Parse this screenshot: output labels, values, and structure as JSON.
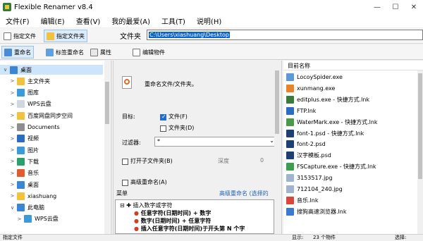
{
  "window": {
    "title": "Flexible Renamer v8.4",
    "minimize": "—",
    "maximize": "☐",
    "close": "✕"
  },
  "menu": [
    "文件(F)",
    "编辑(E)",
    "查看(V)",
    "我的最爱(A)",
    "工具(T)",
    "说明(H)"
  ],
  "toolbar1": {
    "specify_file": "指定文件",
    "specify_folder": "指定文件夹",
    "folder_label": "文件夹",
    "path": "C:\\Users\\xiashuang\\Desktop"
  },
  "toolbar2": {
    "rename": "重命名",
    "tag_rename": "标签重命名",
    "attributes": "属性",
    "edit_items": "编辑物件"
  },
  "tree": [
    {
      "label": "桌面",
      "icon_color": "#3a86d4",
      "chev": "∨",
      "selected": true
    },
    {
      "label": "主文件夹",
      "icon_color": "#f3c23c",
      "chev": ">"
    },
    {
      "label": "图库",
      "icon_color": "#3b9bd8",
      "chev": ">"
    },
    {
      "label": "WPS云盘",
      "icon_color": "#d0d7e2",
      "chev": ">"
    },
    {
      "label": "百度网盘同步空间",
      "icon_color": "#f3c23c",
      "chev": ">"
    },
    {
      "label": "Documents",
      "icon_color": "#8e8e8e",
      "chev": ">"
    },
    {
      "label": "视频",
      "icon_color": "#2b6cc4",
      "chev": ">"
    },
    {
      "label": "图片",
      "icon_color": "#3b9bd8",
      "chev": ">"
    },
    {
      "label": "下载",
      "icon_color": "#2aa06e",
      "chev": ">"
    },
    {
      "label": "音乐",
      "icon_color": "#e05c30",
      "chev": ">"
    },
    {
      "label": "桌面",
      "icon_color": "#3a86d4",
      "chev": ">"
    },
    {
      "label": "xiashuang",
      "icon_color": "#f3c23c",
      "chev": ">"
    },
    {
      "label": "此电脑",
      "icon_color": "#3a86d4",
      "chev": "∨"
    },
    {
      "label": "WPS云盘",
      "icon_color": "#3b9bd8",
      "chev": ">"
    }
  ],
  "rename_panel": {
    "header": "重命名文件/文件夹。",
    "target_label": "目标:",
    "opt_file": "文件(F)",
    "opt_folder": "文件夹(D)",
    "filter_label": "过滤器:",
    "filter_value": "*",
    "open_subfolder": "打开子文件夹(B)",
    "depth_label": "深度",
    "depth_value": "0",
    "advanced_rename": "高级重命名(A)",
    "menu_label": "菜单",
    "advanced_link": "高级重命名 (选择的",
    "menu_tree_root": "插入数字或字符",
    "menu_tree_items": [
      "任意字符(日期时间) + 数字",
      "数字(日期时间) + 任意字符",
      "插入任意字符(日期时间)于开头第 N 个字"
    ]
  },
  "file_list": {
    "header": "目前名称",
    "items": [
      {
        "name": "LocoySpider.exe",
        "color": "#5b9ad6"
      },
      {
        "name": "xunmang.exe",
        "color": "#e8832a"
      },
      {
        "name": "editplus.exe - 快捷方式.lnk",
        "color": "#3a7a3a"
      },
      {
        "name": "FTP.lnk",
        "color": "#2b6cc4"
      },
      {
        "name": "WaterMark.exe - 快捷方式.lnk",
        "color": "#4a9a4a"
      },
      {
        "name": "font-1.psd - 快捷方式.lnk",
        "color": "#1c3f77"
      },
      {
        "name": "font-2.psd",
        "color": "#1c3f77"
      },
      {
        "name": "汉字模板.psd",
        "color": "#1c3f77"
      },
      {
        "name": "FSCapture.exe - 快捷方式.lnk",
        "color": "#3aa04a"
      },
      {
        "name": "3153517.jpg",
        "color": "#9fb4cf"
      },
      {
        "name": "712104_240.jpg",
        "color": "#9fb4cf"
      },
      {
        "name": "音乐.lnk",
        "color": "#d9463a"
      },
      {
        "name": "搜狗高速浏览器.lnk",
        "color": "#3a7ad4"
      }
    ]
  },
  "status": {
    "left": "指定文件",
    "display": "显示:",
    "count": "23 个物件",
    "select": "选择:"
  }
}
